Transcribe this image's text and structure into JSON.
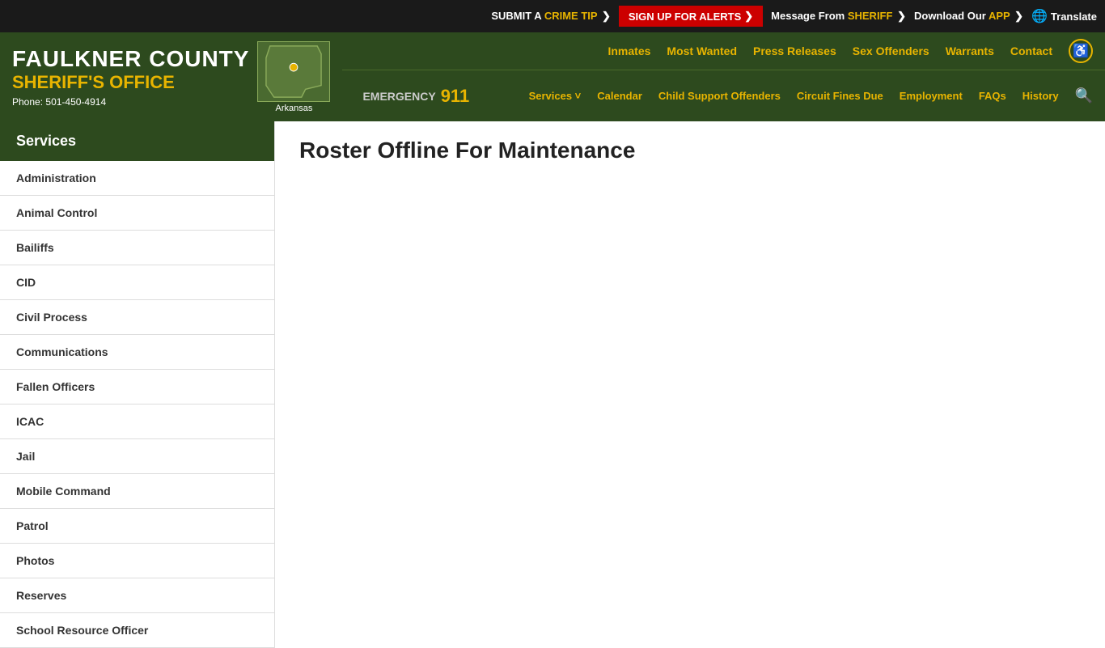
{
  "topbar": {
    "crime_tip": "SUBMIT A ",
    "crime_tip_highlight": "CRIME TIP",
    "crime_tip_arrow": "❯",
    "alert_btn": "SIGN UP FOR ALERTS",
    "alert_arrow": "❯",
    "sheriff_msg": "Message From ",
    "sheriff_highlight": "SHERIFF",
    "sheriff_arrow": "❯",
    "app_label": "Download Our ",
    "app_highlight": "APP",
    "app_arrow": "❯",
    "translate": "Translate"
  },
  "header": {
    "county": "FAULKNER COUNTY",
    "office": "SHERIFF'S OFFICE",
    "phone_label": "Phone:",
    "phone": "501-450-4914",
    "state": "Arkansas"
  },
  "nav_top": {
    "links": [
      "Inmates",
      "Most Wanted",
      "Press Releases",
      "Sex Offenders",
      "Warrants",
      "Contact"
    ]
  },
  "nav_bottom": {
    "emergency_label": "EMERGENCY",
    "emergency_number": "911",
    "links": [
      "Services ˅",
      "Calendar",
      "Child Support Offenders",
      "Circuit Fines Due",
      "Employment",
      "FAQs",
      "History"
    ]
  },
  "sidebar": {
    "header": "Services",
    "items": [
      "Administration",
      "Animal Control",
      "Bailiffs",
      "CID",
      "Civil Process",
      "Communications",
      "Fallen Officers",
      "ICAC",
      "Jail",
      "Mobile Command",
      "Patrol",
      "Photos",
      "Reserves",
      "School Resource Officer"
    ]
  },
  "main": {
    "title": "Roster Offline For Maintenance"
  }
}
